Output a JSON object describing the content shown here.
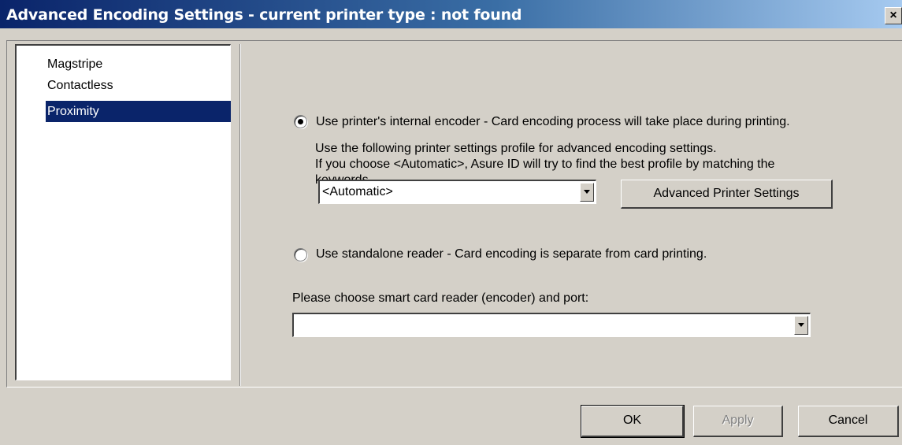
{
  "window": {
    "title": "Advanced Encoding Settings - current printer type : not found",
    "close_label": "×"
  },
  "sidebar": {
    "items": [
      {
        "label": "Magstripe",
        "selected": false
      },
      {
        "label": "Contactless",
        "selected": false
      },
      {
        "label": "Proximity",
        "selected": true
      }
    ]
  },
  "internal_encoder": {
    "radio_label": "Use printer's internal encoder - Card encoding process will take place during printing.",
    "checked": true,
    "description_line1": "Use the following printer settings profile for advanced encoding settings.",
    "description_line2": "If you choose <Automatic>, Asure ID will try to find the best profile by matching the",
    "description_line3": "keywords.",
    "profile_value": "<Automatic>",
    "advanced_button_label": "Advanced Printer Settings"
  },
  "standalone_reader": {
    "radio_label": "Use standalone reader - Card encoding is separate from card printing.",
    "checked": false,
    "port_prompt": "Please choose smart card reader (encoder) and port:",
    "port_value": ""
  },
  "footer": {
    "ok_label": "OK",
    "apply_label": "Apply",
    "cancel_label": "Cancel"
  },
  "colors": {
    "face": "#d4d0c8",
    "selection": "#0a246a",
    "title_gradient_start": "#0a246a",
    "title_gradient_end": "#a6caf0"
  },
  "icons": {
    "close": "close-icon",
    "dropdown": "chevron-down-icon"
  }
}
